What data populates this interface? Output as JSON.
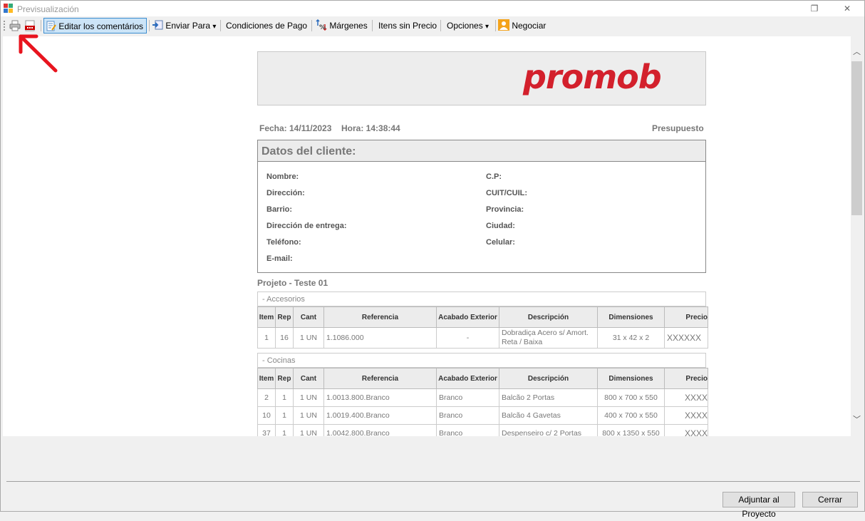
{
  "window": {
    "title": "Previsualización",
    "restore_glyph": "❐",
    "close_glyph": "✕",
    "app_icon": "window-grid-icon"
  },
  "toolbar": {
    "print_icon": "printer-icon",
    "pdf_icon": "pdf-icon",
    "edit_comments": "Editar los comentários",
    "send_to": "Enviar Para",
    "payment_conditions": "Condiciones de Pago",
    "margins": "Márgenes",
    "items_no_price": "Itens sin Precio",
    "options": "Opciones",
    "negotiate": "Negociar",
    "dropdown_glyph": "▾"
  },
  "doc": {
    "logo": "promob",
    "fecha": "Fecha: 14/11/2023",
    "hora": "Hora: 14:38:44",
    "doc_type": "Presupuesto",
    "client_title": "Datos del cliente:",
    "client_fields_left": [
      "Nombre:",
      "Dirección:",
      "Barrio:",
      "Dirección de entrega:",
      "Teléfono:",
      "E-mail:"
    ],
    "client_fields_right": [
      "C.P:",
      "CUIT/CUIL:",
      "Provincia:",
      "Ciudad:",
      "Celular:"
    ],
    "project": "Projeto - Teste 01",
    "columns": [
      "Item",
      "Rep",
      "Cant",
      "Referencia",
      "Acabado Exterior",
      "Descripción",
      "Dimensiones",
      "Precio"
    ],
    "sections": [
      {
        "label": "- Accesorios",
        "rows": [
          {
            "item": "1",
            "rep": "16",
            "cant": "1 UN",
            "ref": "1.1086.000",
            "acabado": "-",
            "desc": "Dobradiça Acero s/ Amort. Reta / Baixa",
            "dim": "31 x 42 x 2",
            "precio": "XXXXXX"
          }
        ]
      },
      {
        "label": "- Cocinas",
        "rows": [
          {
            "item": "2",
            "rep": "1",
            "cant": "1 UN",
            "ref": "1.0013.800.Branco",
            "acabado": "Branco",
            "desc": "Balcão 2 Portas",
            "dim": "800 x 700 x 550",
            "precio": "XXXX"
          },
          {
            "item": "10",
            "rep": "1",
            "cant": "1 UN",
            "ref": "1.0019.400.Branco",
            "acabado": "Branco",
            "desc": "Balcão 4 Gavetas",
            "dim": "400 x 700 x 550",
            "precio": "XXXX"
          },
          {
            "item": "37",
            "rep": "1",
            "cant": "1 UN",
            "ref": "1.0042.800.Branco",
            "acabado": "Branco",
            "desc": "Despenseiro c/ 2 Portas",
            "dim": "800 x 1350 x 550",
            "precio": "XXXX"
          }
        ]
      }
    ]
  },
  "footer": {
    "attach_button": "Adjuntar al Proyecto",
    "close_button": "Cerrar"
  },
  "colors": {
    "logo_red": "#d3202c",
    "annotation_red": "#e8141e",
    "active_tool_bg": "#cce4f7"
  }
}
